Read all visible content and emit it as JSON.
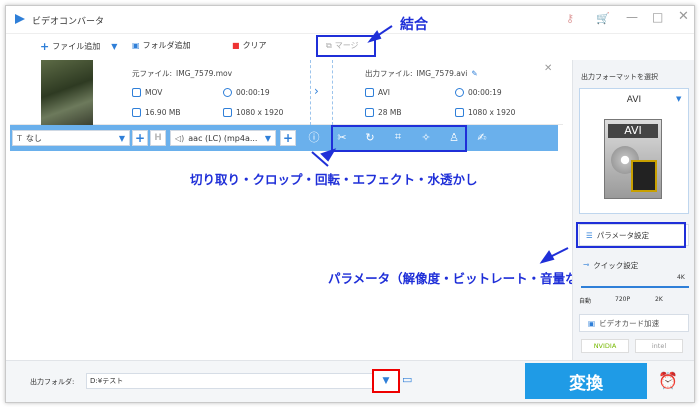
{
  "window": {
    "title": "ビデオコンバータ"
  },
  "toolbar": {
    "add_file": "ファイル追加",
    "add_folder": "フォルダ追加",
    "clear": "クリア",
    "merge": "マージ"
  },
  "file": {
    "source_label": "元ファイル:",
    "source_name": "IMG_7579.mov",
    "src_format": "MOV",
    "src_duration": "00:00:19",
    "src_size": "16.90 MB",
    "src_resolution": "1080 x 1920",
    "output_label": "出力ファイル:",
    "output_name": "IMG_7579.avi",
    "out_format": "AVI",
    "out_duration": "00:00:19",
    "out_size": "28 MB",
    "out_resolution": "1080 x 1920"
  },
  "editbar": {
    "subtitle": "なし",
    "audio": "aac (LC) (mp4a...",
    "h_label": "H"
  },
  "right": {
    "select_format": "出力フォーマットを選択",
    "format": "AVI",
    "format_icon": "AVI",
    "param_settings": "パラメータ設定",
    "quick_settings": "クイック設定",
    "q_4k": "4K",
    "q_auto": "自動",
    "q_720": "720P",
    "q_2k": "2K",
    "gpu_accel": "ビデオカード加速",
    "nvidia": "NVIDIA",
    "intel": "intel"
  },
  "bottom": {
    "output_folder_label": "出力フォルダ:",
    "output_folder_value": "D:¥テスト",
    "convert": "変換"
  },
  "annotations": {
    "merge": "結合",
    "edit_tools": "切り取り・クロップ・回転・エフェクト・水透かし",
    "params": "パラメータ（解像度・ビットレート・音量など）変更"
  },
  "colors": {
    "accent": "#2f7fd8",
    "edit_bar": "#6ab0ec",
    "convert_button": "#1f9be6",
    "annotation": "#1f2fd8",
    "highlight_red": "#e00000"
  }
}
